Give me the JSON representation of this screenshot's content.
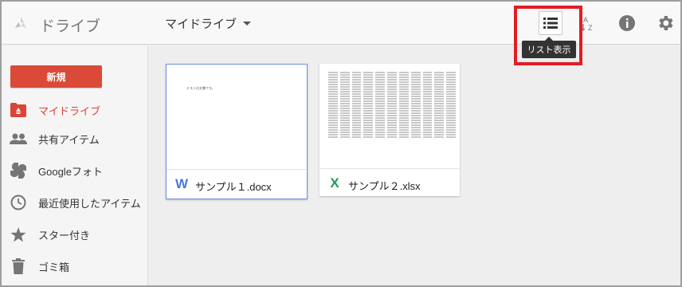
{
  "header": {
    "app_title": "ドライブ",
    "location": "マイドライブ",
    "list_view_tooltip": "リスト表示"
  },
  "sidebar": {
    "new_label": "新規",
    "items": [
      {
        "label": "マイドライブ",
        "icon": "my-drive-icon",
        "active": true
      },
      {
        "label": "共有アイテム",
        "icon": "shared-people-icon",
        "active": false
      },
      {
        "label": "Googleフォト",
        "icon": "google-photos-icon",
        "active": false
      },
      {
        "label": "最近使用したアイテム",
        "icon": "clock-icon",
        "active": false
      },
      {
        "label": "スター付き",
        "icon": "star-icon",
        "active": false
      },
      {
        "label": "ゴミ箱",
        "icon": "trash-icon",
        "active": false
      }
    ]
  },
  "files": [
    {
      "name": "サンプル１.docx",
      "type": "word",
      "icon_letter": "W",
      "preview_text": "テストの文書です。",
      "selected": true
    },
    {
      "name": "サンプル２.xlsx",
      "type": "excel",
      "icon_letter": "X",
      "selected": false
    }
  ],
  "colors": {
    "accent_red": "#db4437",
    "new_button": "#db4a39",
    "word_blue": "#4a7bd4",
    "excel_green": "#1d9b5a",
    "highlight_box": "#e21d24"
  }
}
